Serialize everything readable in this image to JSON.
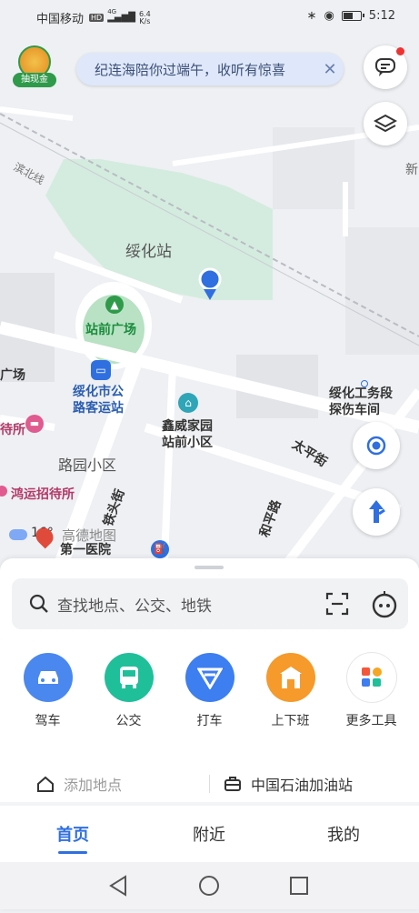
{
  "status": {
    "carrier": "中国移动",
    "hd": "HD",
    "net": "4G",
    "speed_value": "6.4",
    "speed_unit": "K/s",
    "time": "5:12",
    "battery_level": 0.6
  },
  "map": {
    "notice_text": "纪连海陪你过端午，收听有惊喜",
    "coupon_label": "抽现金",
    "labels": {
      "suihua_station": "绥化站",
      "station_square": "站前广场",
      "bus_station_line1": "绥化市公",
      "bus_station_line2": "路客运站",
      "workshop_line1": "绥化工务段",
      "workshop_line2": "探伤车间",
      "xinwei_line1": "鑫威家园",
      "xinwei_line2": "站前小区",
      "luyuan": "路园小区",
      "taiping_street": "太平街",
      "heping_road": "和平路",
      "tietou_street": "铁头街",
      "hongyun": "鸿运招待所",
      "hospital": "第一医院",
      "suo_partial": "待所",
      "chang_partial": "广场",
      "binbei_line": "滨北线",
      "xin_partial": "新",
      "weather": "16°",
      "gaode_watermark": "高德地图"
    }
  },
  "search": {
    "placeholder": "查找地点、公交、地铁"
  },
  "tools": [
    {
      "label": "驾车",
      "icon": "car-icon",
      "color": "#4a88ef"
    },
    {
      "label": "公交",
      "icon": "bus-icon",
      "color": "#1fbf9a"
    },
    {
      "label": "打车",
      "icon": "taxi-icon",
      "color": "#3d7ef0"
    },
    {
      "label": "上下班",
      "icon": "commute-icon",
      "color": "#f59a2b"
    },
    {
      "label": "更多工具",
      "icon": "more-tools-icon",
      "color": "#ffffff"
    }
  ],
  "quick": {
    "add_place": "添加地点",
    "work_place": "中国石油加油站"
  },
  "tabs": {
    "home": "首页",
    "nearby": "附近",
    "mine": "我的"
  }
}
